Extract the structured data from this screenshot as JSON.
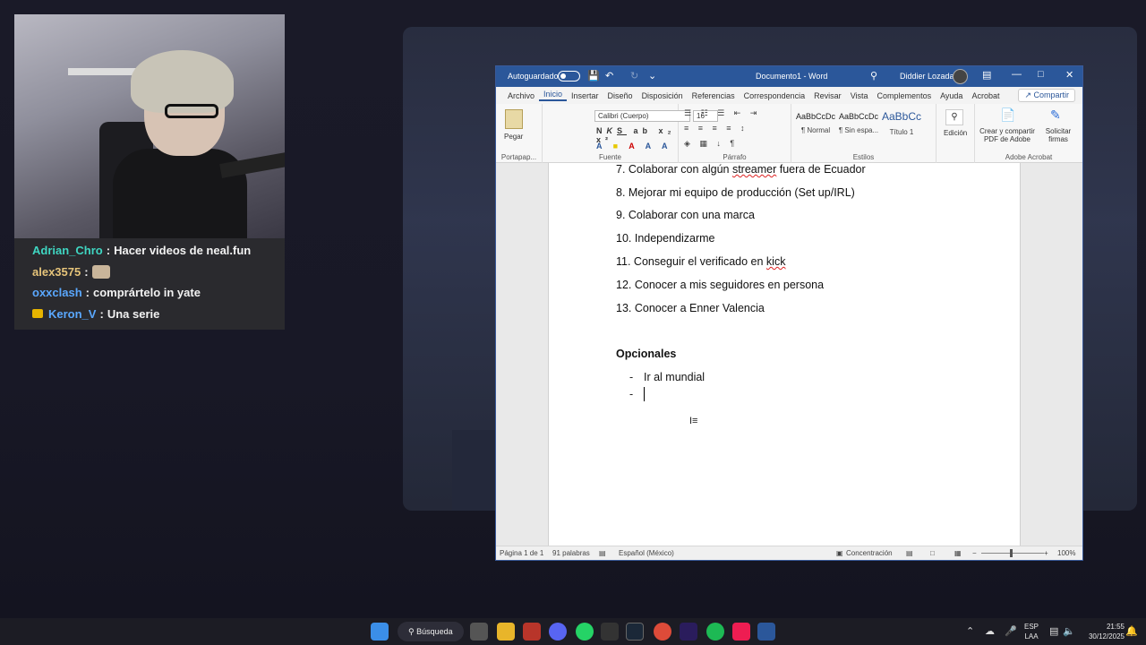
{
  "chat": [
    {
      "user": "Adrian_Chro",
      "color": "#3fd6c2",
      "sep": ":",
      "message": "Hacer videos de neal.fun",
      "badge": false,
      "emote": false
    },
    {
      "user": "alex3575",
      "color": "#e6c47a",
      "sep": ":",
      "message": "",
      "badge": false,
      "emote": true
    },
    {
      "user": "oxxclash",
      "color": "#5aa8ff",
      "sep": ":",
      "message": "comprártelo in yate",
      "badge": false,
      "emote": false
    },
    {
      "user": "Keron_V",
      "color": "#5aa8ff",
      "sep": ":",
      "message": "Una serie",
      "badge": true,
      "emote": false
    }
  ],
  "word": {
    "autosave_label": "Autoguardado",
    "doc_title": "Documento1 - Word",
    "user_name": "Diddier Lozada",
    "menu": [
      "Archivo",
      "Inicio",
      "Insertar",
      "Diseño",
      "Disposición",
      "Referencias",
      "Correspondencia",
      "Revisar",
      "Vista",
      "Complementos",
      "Ayuda",
      "Acrobat"
    ],
    "share_label": "Compartir",
    "ribbon": {
      "paste_label": "Pegar",
      "clipboard_label": "Portapap...",
      "font_name": "Calibri (Cuerpo)",
      "font_size": "16",
      "font_group_label": "Fuente",
      "paragraph_group_label": "Párrafo",
      "styles_group_label": "Estilos",
      "styles": [
        {
          "preview": "AaBbCcDc",
          "name": "¶ Normal"
        },
        {
          "preview": "AaBbCcDc",
          "name": "¶ Sin espa..."
        },
        {
          "preview": "AaBbCc",
          "name": "Título 1"
        }
      ],
      "editing_label": "Edición",
      "acrobat_create_label_1": "Crear y compartir",
      "acrobat_create_label_2": "PDF de Adobe",
      "acrobat_sign_label_1": "Solicitar",
      "acrobat_sign_label_2": "firmas",
      "acrobat_group_label": "Adobe Acrobat"
    },
    "document": {
      "list_items": [
        {
          "prefix": "7. Colaborar con algún ",
          "underlined": "streamer",
          "suffix": " fuera de Ecuador"
        },
        {
          "prefix": "8. Mejorar mi equipo de producción (Set up/IRL)",
          "underlined": "",
          "suffix": ""
        },
        {
          "prefix": "9. Colaborar con una marca",
          "underlined": "",
          "suffix": ""
        },
        {
          "prefix": "10. Independizarme",
          "underlined": "",
          "suffix": ""
        },
        {
          "prefix": "11. Conseguir el verificado en ",
          "underlined": "kick",
          "suffix": ""
        },
        {
          "prefix": "12. Conocer a mis seguidores en persona",
          "underlined": "",
          "suffix": ""
        },
        {
          "prefix": "13. Conocer a Enner Valencia",
          "underlined": "",
          "suffix": ""
        }
      ],
      "optional_heading": "Opcionales",
      "optional_bullets": [
        "Ir al mundial",
        ""
      ],
      "bullet_char": "-"
    },
    "status": {
      "page": "Página 1 de 1",
      "words": "91 palabras",
      "language": "Español (México)",
      "focus": "Concentración",
      "zoom": "100%",
      "zoom_minus": "−",
      "zoom_plus": "+"
    }
  },
  "taskbar": {
    "search_label": "Búsqueda",
    "lang_1": "ESP",
    "lang_2": "LAA",
    "time": "21:55",
    "date": "30/12/2025"
  }
}
